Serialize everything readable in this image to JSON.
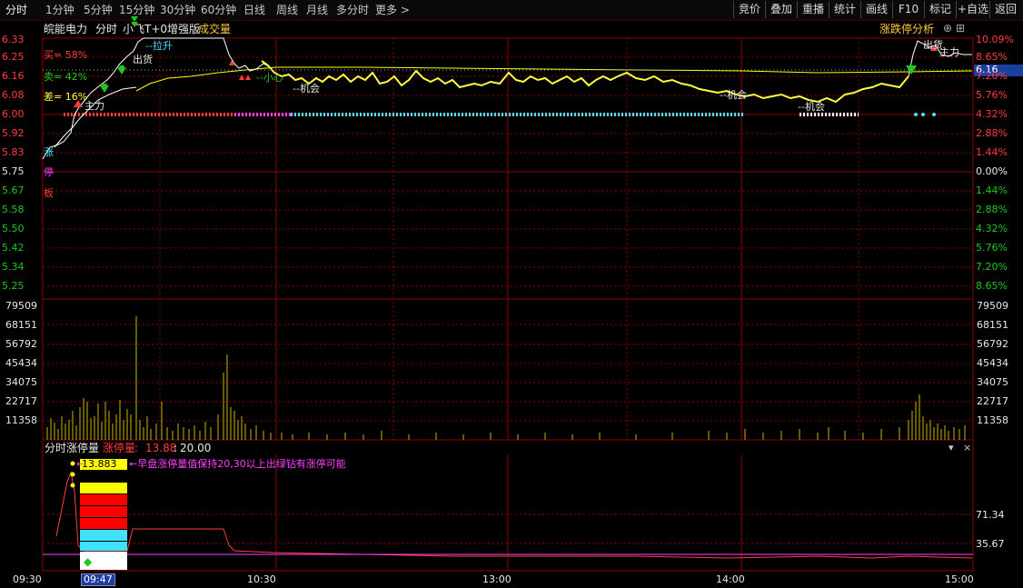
{
  "toolbar": {
    "tabs": [
      "分时",
      "1分钟",
      "5分钟",
      "15分钟",
      "30分钟",
      "60分钟",
      "日线",
      "周线",
      "月线",
      "多分时",
      "更多 >"
    ],
    "buttons": [
      "竞价",
      "叠加",
      "重播",
      "统计",
      "画线",
      "F10",
      "标记",
      "+自选",
      "返回"
    ]
  },
  "header": {
    "stock_name": "皖能电力",
    "chart_mode": "分时",
    "indicator_name": "小飞T+0增强版",
    "volume_label": "成交量",
    "analysis_label": "涨跌停分析"
  },
  "price_axis_left": [
    "6.33",
    "6.25",
    "6.16",
    "6.08",
    "6.00",
    "5.92",
    "5.83",
    "5.75",
    "5.67",
    "5.58",
    "5.50",
    "5.42",
    "5.34",
    "5.25"
  ],
  "price_axis_right": [
    "10.09%",
    "8.65%",
    "7.20%",
    "5.76%",
    "4.32%",
    "2.88%",
    "1.44%",
    "0.00%",
    "1.44%",
    "2.88%",
    "4.32%",
    "5.76%",
    "7.20%",
    "8.65%"
  ],
  "current_price_tag": "6.16",
  "volume_axis": [
    "79509",
    "68151",
    "56792",
    "45434",
    "34075",
    "22717",
    "11358"
  ],
  "signals": {
    "buy_pct": "买= 58%",
    "sell_pct": "卖= 42%",
    "diff_pct": "差= 16%",
    "zhang": "涨",
    "ting": "停",
    "ban": "板",
    "zhuli": "主力",
    "chuhuo": "出货",
    "lasheng": "--拉升",
    "xiaoxin": "--小心",
    "jihui": "--机会",
    "zhuli_right": "主力",
    "chuhuo_right": "出货"
  },
  "sub_panel": {
    "title": "分时涨停量",
    "key_label": "涨停量",
    "value": "13.88",
    "separator": ":",
    "threshold": "20.00",
    "annotation_value": "13.883",
    "annotation_text": "←早盘涨停量值保持20,30以上出绿钻有涨停可能",
    "axis_top": "71.34",
    "axis_bottom": "35.67"
  },
  "time_axis": [
    "09:30",
    "09:47",
    "10:30",
    "13:00",
    "14:00",
    "15:00"
  ],
  "colors": {
    "grid": "#8b0000",
    "price_line": "#ffffff",
    "avg_line": "#ffff00",
    "up": "#ff3c3c",
    "down": "#1ec81e",
    "volume": "#c8b400"
  }
}
